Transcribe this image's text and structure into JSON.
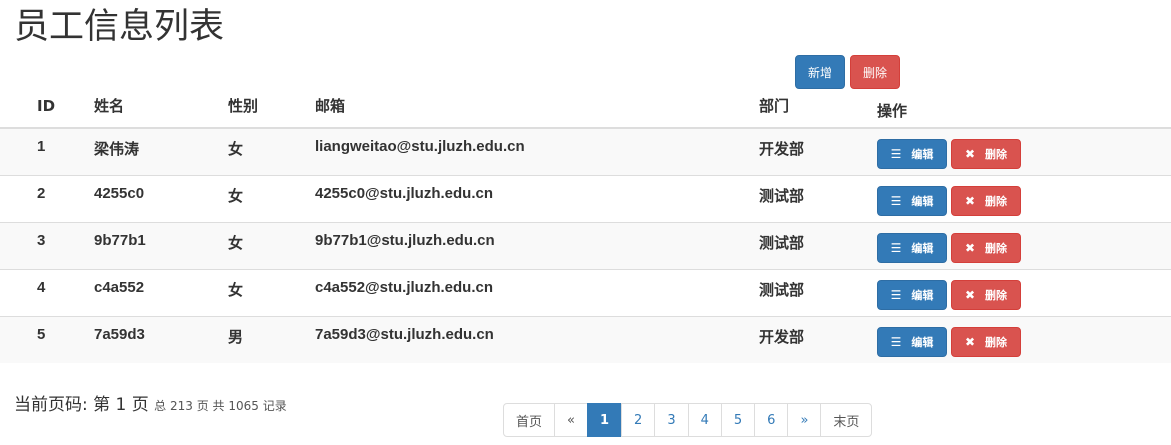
{
  "title": "员工信息列表",
  "toolbar": {
    "add_label": "新增",
    "delete_label": "删除"
  },
  "table": {
    "headers": [
      "ID",
      "姓名",
      "性别",
      "邮箱",
      "部门",
      "操作"
    ],
    "rows": [
      {
        "id": "1",
        "name": "梁伟涛",
        "gender": "女",
        "email": "liangweitao@stu.jluzh.edu.cn",
        "dept": "开发部"
      },
      {
        "id": "2",
        "name": "4255c0",
        "gender": "女",
        "email": "4255c0@stu.jluzh.edu.cn",
        "dept": "测试部"
      },
      {
        "id": "3",
        "name": "9b77b1",
        "gender": "女",
        "email": "9b77b1@stu.jluzh.edu.cn",
        "dept": "测试部"
      },
      {
        "id": "4",
        "name": "c4a552",
        "gender": "女",
        "email": "c4a552@stu.jluzh.edu.cn",
        "dept": "测试部"
      },
      {
        "id": "5",
        "name": "7a59d3",
        "gender": "男",
        "email": "7a59d3@stu.jluzh.edu.cn",
        "dept": "开发部"
      }
    ],
    "row_actions": {
      "edit_label": "编辑",
      "delete_label": "删除",
      "edit_icon": "list-icon",
      "delete_icon": "close-icon"
    }
  },
  "page_info": {
    "prefix": "当前页码: 第 1 页",
    "summary": "总 213 页 共 1065 记录"
  },
  "pagination": {
    "first": "首页",
    "prev": "«",
    "pages": [
      "1",
      "2",
      "3",
      "4",
      "5",
      "6"
    ],
    "active_page": "1",
    "next": "»",
    "last": "末页"
  },
  "colors": {
    "primary": "#337ab7",
    "danger": "#d9534f"
  }
}
